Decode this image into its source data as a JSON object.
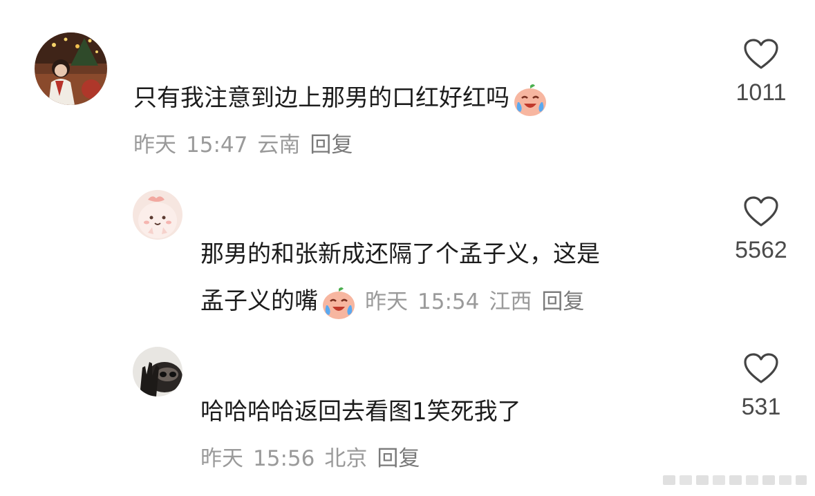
{
  "comments": [
    {
      "text": "只有我注意到边上那男的口红好红吗",
      "emoji": "laughing-crying-emoji",
      "date": "昨天",
      "time": "15:47",
      "location": "云南",
      "reply_label": "回复",
      "likes": "1011"
    },
    {
      "text_line1": "那男的和张新成还隔了个孟子义，这是",
      "text_line2": "孟子义的嘴",
      "emoji": "laughing-crying-emoji",
      "date": "昨天",
      "time": "15:54",
      "location": "江西",
      "reply_label": "回复",
      "likes": "5562"
    },
    {
      "text": "哈哈哈哈返回去看图1笑死我了",
      "date": "昨天",
      "time": "15:56",
      "location": "北京",
      "reply_label": "回复",
      "likes": "531"
    }
  ],
  "icons": {
    "like": "heart-outline-icon"
  },
  "colors": {
    "text": "#1c1c1c",
    "meta": "#9a9a9a",
    "like_count": "#4a4a4a"
  }
}
